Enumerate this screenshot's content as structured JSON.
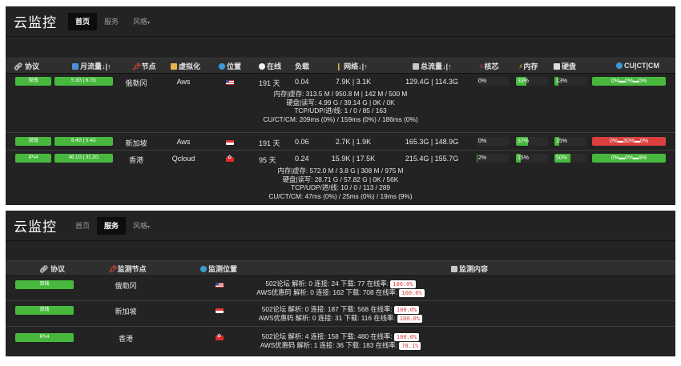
{
  "colors": {
    "accent": "#47b83d",
    "danger": "#d9403f",
    "panel": "#232323"
  },
  "app": {
    "brand": "云监控",
    "nav": {
      "home": "首页",
      "services": "服务",
      "style": "风格",
      "style_caret": "▾"
    }
  },
  "overview": {
    "headers": {
      "protocol": "协议",
      "month_traffic": "月流量↓|↑",
      "node": "节点",
      "virt": "虚拟化",
      "location": "位置",
      "online": "在线",
      "load": "负载",
      "network": "网络↓|↑",
      "total_traffic": "总流量↓|↑",
      "cpu": "核芯",
      "memory": "内存",
      "disk": "硬盘",
      "isp": "CU|CT|CM"
    },
    "rows": [
      {
        "protocol": "双栈",
        "month": "5.3G | 6.7G",
        "node": "俄勒冈",
        "virt": "Aws",
        "flag": "us",
        "online": "191 天",
        "load": "0.04",
        "network": "7.9K | 3.1K",
        "total": "129.4G | 114.3G",
        "cpu": "0%",
        "cpu_level": 0,
        "mem": "33%",
        "mem_level": 33,
        "disk": "13%",
        "disk_level": 13,
        "isp": "0%▬0%▬0%",
        "isp_alert": false,
        "details": [
          "内存|虚存: 313.5 M / 950.8 M | 142 M / 500 M",
          "硬盘|读写: 4.99 G / 39.14 G | 0K / 0K",
          "TCP/UDP/进/线: 1 / 0 / 85 / 163",
          "CU/CT/CM: 209ms (0%) / 159ms (0%) / 186ms (0%)"
        ]
      },
      {
        "protocol": "双栈",
        "month": "8.4G | 5.4G",
        "node": "新加坡",
        "virt": "Aws",
        "flag": "sg",
        "online": "191 天",
        "load": "0.06",
        "network": "2.7K | 1.9K",
        "total": "165.3G | 148.9G",
        "cpu": "0%",
        "cpu_level": 0,
        "mem": "37%",
        "mem_level": 37,
        "disk": "15%",
        "disk_level": 15,
        "isp": "0%▬30%▬0%",
        "isp_alert": true,
        "details": []
      },
      {
        "protocol": "IPv4",
        "month": "46.1G | 31.2G",
        "node": "香港",
        "virt": "Qcloud",
        "flag": "hk",
        "online": "95 天",
        "load": "0.24",
        "network": "15.9K | 17.5K",
        "total": "215.4G | 155.7G",
        "cpu": "2%",
        "cpu_level": 2,
        "mem": "15%",
        "mem_level": 15,
        "disk": "50%",
        "disk_level": 50,
        "isp": "0%▬0%▬9%",
        "isp_alert": false,
        "details": [
          "内存|虚存: 572.0 M / 3.8 G | 308 M / 975 M",
          "硬盘|读写: 28.71 G / 57.82 G | 0K / 56K",
          "TCP/UDP/进/线: 10 / 0 / 113 / 289",
          "CU/CT/CM: 47ms (0%) / 25ms (0%) / 19ms (9%)"
        ]
      }
    ]
  },
  "services": {
    "headers": {
      "protocol": "协议",
      "node": "监测节点",
      "location": "监测位置",
      "content": "监测内容"
    },
    "rows": [
      {
        "protocol": "双栈",
        "node": "俄勒冈",
        "flag": "us",
        "lines": [
          {
            "text": "502论坛 解析: 0 连接: 24 下载: 77 在线率:",
            "rate": "100.0%"
          },
          {
            "text": "AWS优惠码 解析: 0 连接: 162 下载: 708 在线率:",
            "rate": "100.0%"
          }
        ]
      },
      {
        "protocol": "双栈",
        "node": "新加坡",
        "flag": "sg",
        "lines": [
          {
            "text": "502论坛 解析: 0 连接: 187 下载: 568 在线率:",
            "rate": "100.0%"
          },
          {
            "text": "AWS优惠码 解析: 0 连接: 31 下载: 116 在线率:",
            "rate": "100.0%"
          }
        ]
      },
      {
        "protocol": "IPv4",
        "node": "香港",
        "flag": "hk",
        "lines": [
          {
            "text": "502论坛 解析: 4 连接: 158 下载: 480 在线率:",
            "rate": "100.0%"
          },
          {
            "text": "AWS优惠码 解析: 1 连接: 36 下载: 183 在线率:",
            "rate": "78.1%"
          }
        ]
      }
    ]
  }
}
